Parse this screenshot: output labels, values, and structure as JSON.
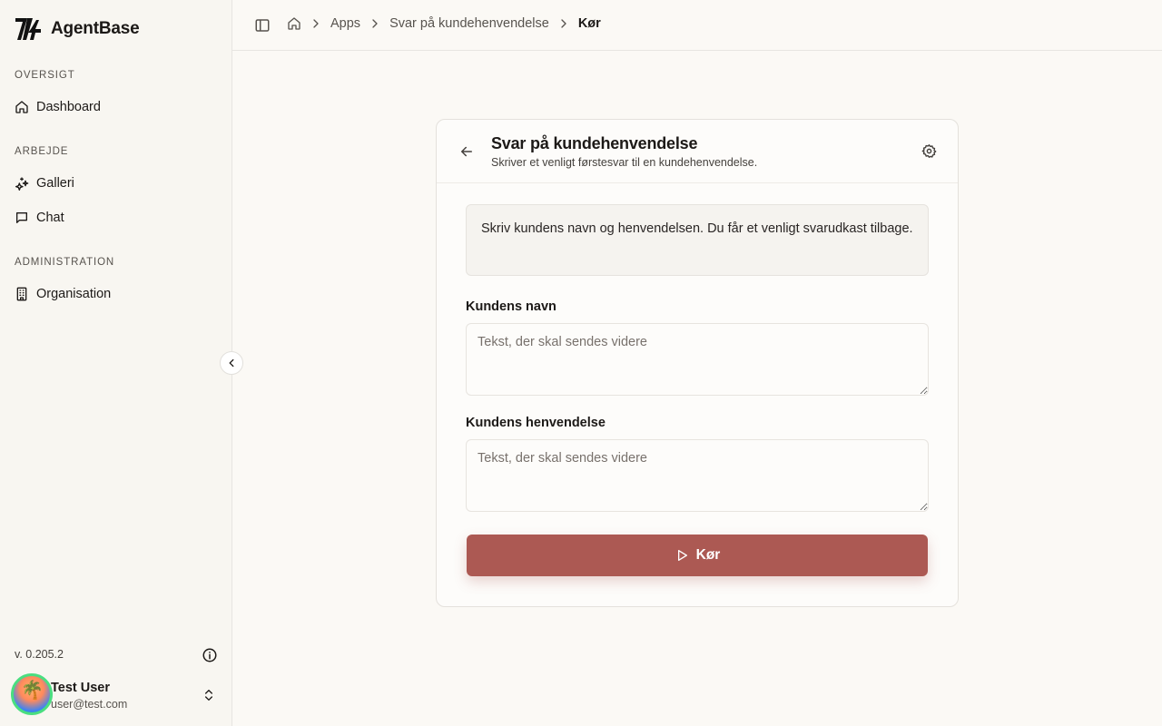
{
  "app": {
    "name": "AgentBase",
    "version": "v. 0.205.2"
  },
  "sidebar": {
    "sections": [
      {
        "title": "OVERSIGT",
        "items": [
          {
            "label": "Dashboard",
            "icon": "home-icon"
          }
        ]
      },
      {
        "title": "ARBEJDE",
        "items": [
          {
            "label": "Galleri",
            "icon": "sparkles-icon"
          },
          {
            "label": "Chat",
            "icon": "chat-icon"
          }
        ]
      },
      {
        "title": "ADMINISTRATION",
        "items": [
          {
            "label": "Organisation",
            "icon": "building-icon"
          }
        ]
      }
    ]
  },
  "user": {
    "name": "Test User",
    "email": "user@test.com"
  },
  "breadcrumb": {
    "home_icon": "home-icon",
    "items": [
      "Apps",
      "Svar på kundehenvendelse"
    ],
    "current": "Kør"
  },
  "card": {
    "title": "Svar på kundehenvendelse",
    "subtitle": "Skriver et venligt førstesvar til en kundehenvendelse.",
    "intro": "Skriv kundens navn og henvendelsen. Du får et venligt svarudkast tilbage.",
    "fields": [
      {
        "label": "Kundens navn",
        "value": "",
        "placeholder": "Tekst, der skal sendes videre"
      },
      {
        "label": "Kundens henvendelse",
        "value": "",
        "placeholder": "Tekst, der skal sendes videre"
      }
    ],
    "run_label": "Kør"
  },
  "colors": {
    "accent": "#ac5953",
    "background": "#fbf9f5",
    "sidebar": "#f8f6f1"
  }
}
